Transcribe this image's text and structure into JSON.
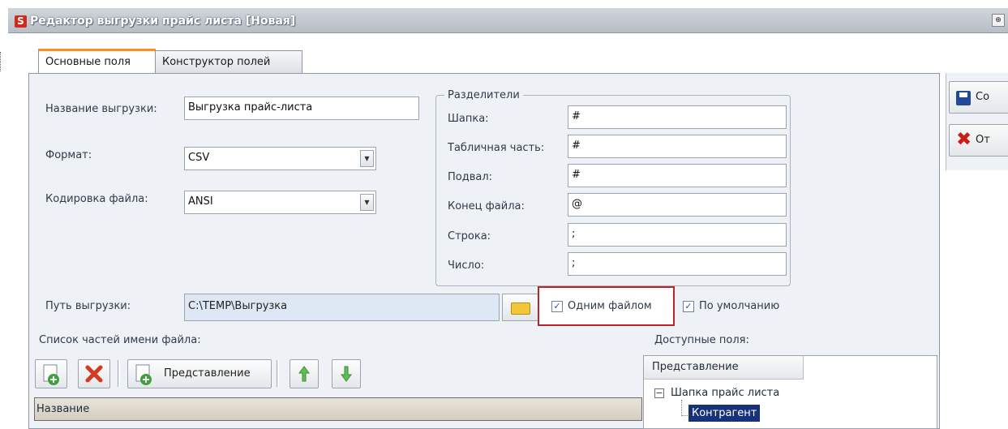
{
  "window": {
    "title": "Редактор выгрузки прайс листа [Новая]",
    "app_icon_glyph": "S",
    "pin_glyph": "⊕"
  },
  "tabs": [
    {
      "label": "Основные поля",
      "active": true
    },
    {
      "label": "Конструктор полей",
      "active": false
    }
  ],
  "form": {
    "name_label": "Название выгрузки:",
    "name_value": "Выгрузка прайс-листа",
    "format_label": "Формат:",
    "format_value": "CSV",
    "encoding_label": "Кодировка файла:",
    "encoding_value": "ANSI",
    "path_label": "Путь выгрузки:",
    "path_value": "C:\\TEMP\\Выгрузка",
    "one_file_label": "Одним файлом",
    "one_file_checked": true,
    "default_label": "По умолчанию",
    "default_checked": true
  },
  "separators": {
    "title": "Разделители",
    "items": [
      {
        "label": "Шапка:",
        "value": "#"
      },
      {
        "label": "Табличная часть:",
        "value": "#"
      },
      {
        "label": "Подвал:",
        "value": "#"
      },
      {
        "label": "Конец файла:",
        "value": "@"
      },
      {
        "label": "Строка:",
        "value": ";"
      },
      {
        "label": "Число:",
        "value": ";"
      }
    ]
  },
  "file_parts": {
    "title": "Список частей имени файла:",
    "toolbar": {
      "representation_label": "Представление"
    },
    "column_header": "Название"
  },
  "available_fields": {
    "title": "Доступные поля:",
    "column_header": "Представление",
    "tree": {
      "root": "Шапка прайс листа",
      "root_expander": "−",
      "selected_child": "Контрагент"
    }
  },
  "side_buttons": [
    {
      "label": "Со",
      "icon": "save-icon"
    },
    {
      "label": "От",
      "icon": "cancel-icon"
    }
  ],
  "colors": {
    "accent_tab": "#ff8c1f",
    "highlight_box": "#b5272c",
    "selection": "#17317a"
  }
}
